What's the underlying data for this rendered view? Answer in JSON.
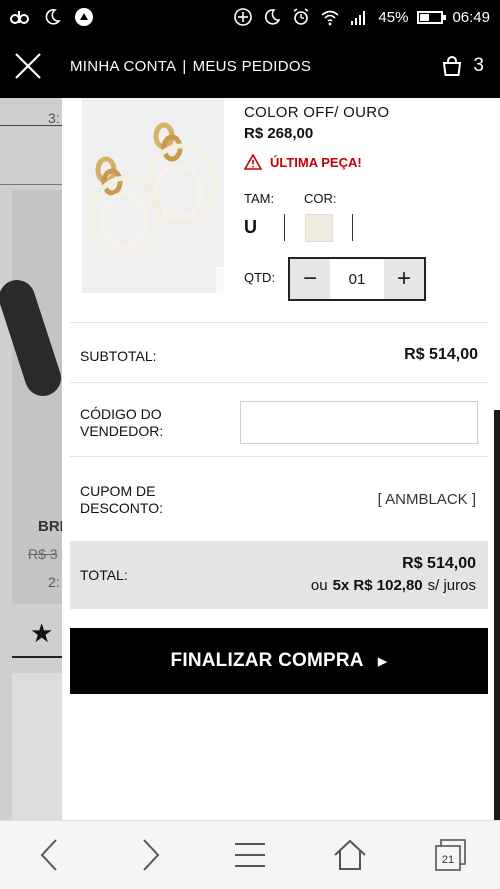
{
  "status_bar": {
    "battery_percent": "45%",
    "battery_level": 0.45,
    "time": "06:49"
  },
  "header": {
    "close_icon": "close-icon",
    "link_account": "MINHA CONTA",
    "separator": "|",
    "link_orders": "MEUS PEDIDOS",
    "bag_icon": "shopping-bag-icon",
    "bag_count": "3"
  },
  "background_page": {
    "qty_top": "3:",
    "brand": "BRI",
    "old_price": "R$ 3",
    "qty": "2:",
    "rating_star": "★"
  },
  "cart_item": {
    "color_name": "COLOR OFF/ OURO",
    "price": "R$ 268,00",
    "warning": "ÚLTIMA PEÇA!",
    "size_label": "TAM:",
    "color_label": "COR:",
    "size_value": "U",
    "swatch_color": "#f0ece0",
    "qty_label": "QTD:",
    "qty_value": "01",
    "qty_minus": "−",
    "qty_plus": "+"
  },
  "summary": {
    "subtotal_label": "SUBTOTAL:",
    "subtotal_value": "R$ 514,00",
    "vendor_label_line1": "CÓDIGO DO",
    "vendor_label_line2": "VENDEDOR:",
    "vendor_input_value": "",
    "coupon_label_line1": "CUPOM DE",
    "coupon_label_line2": "DESCONTO:",
    "coupon_value": "[ ANMBLACK ]",
    "total_label": "TOTAL:",
    "total_value": "R$ 514,00",
    "installments_prefix": "ou",
    "installments_value": "5x R$ 102,80",
    "installments_suffix": "s/ juros"
  },
  "checkout": {
    "label": "FINALIZAR COMPRA",
    "arrow": "▸"
  },
  "browser_nav": {
    "tabs_count": "21"
  },
  "colors": {
    "header_bg": "#000000",
    "warning_red": "#c40000",
    "total_bg": "#e4e4e4"
  }
}
